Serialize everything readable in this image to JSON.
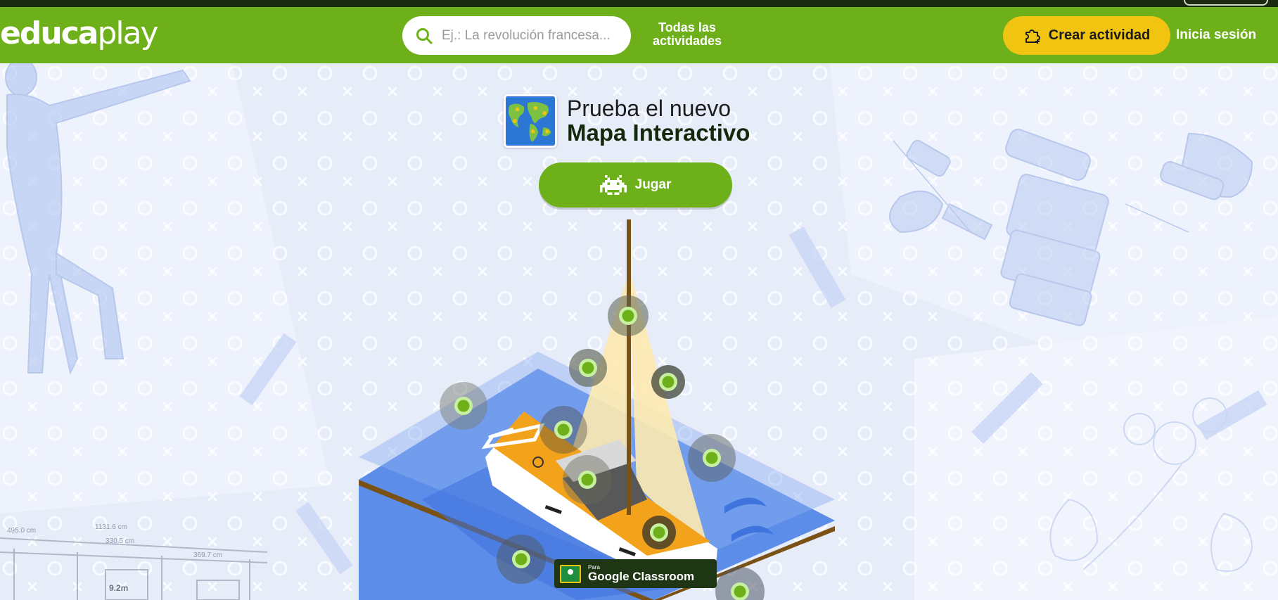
{
  "header": {
    "logo_bold": "educa",
    "logo_light": "play",
    "search_placeholder": "Ej.: La revolución francesa...",
    "nav_all_line1": "Todas las",
    "nav_all_line2": "actividades",
    "create_label": "Crear actividad",
    "login_label": "Inicia sesión"
  },
  "promo": {
    "line1": "Prueba el nuevo",
    "line2": "Mapa Interactivo",
    "play_label": "Jugar"
  },
  "classroom": {
    "small": "Para",
    "big": "Google Classroom"
  },
  "floorplan_labels": {
    "dim1": "495.0 cm",
    "dim2": "1131.6 cm",
    "dim3": "330.5 cm",
    "dim4": "369.7 cm",
    "area": "9.2m"
  },
  "icons": {
    "search": "search-icon",
    "create": "puzzle-plus-icon",
    "play": "space-invader-icon",
    "classroom": "google-classroom-icon"
  },
  "colors": {
    "header_green": "#6db01a",
    "create_yellow": "#f2c412",
    "dark_text": "#14280c",
    "water_blue": "#5c8de8",
    "hotspot_green": "#6db01a"
  }
}
